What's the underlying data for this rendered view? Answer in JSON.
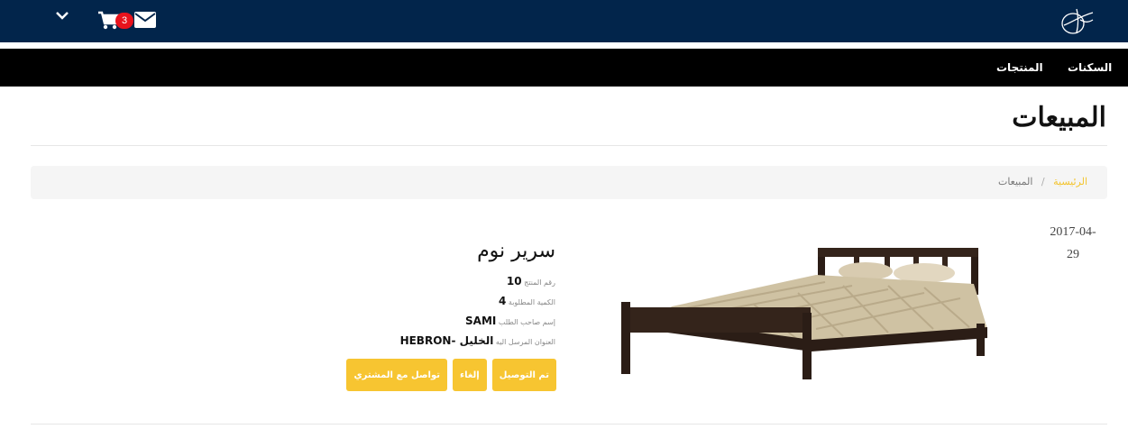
{
  "header": {
    "cart_count": "3",
    "icons": [
      "chevron-down-icon",
      "cart-icon",
      "mail-icon",
      "logo-icon"
    ]
  },
  "nav": {
    "items": [
      {
        "label": "السكنات"
      },
      {
        "label": "المنتجات"
      }
    ]
  },
  "page": {
    "title": "المبيعات"
  },
  "breadcrumb": {
    "home": "الرئيسية",
    "separator": "/",
    "current": "المبيعات"
  },
  "order": {
    "date_line1": "2017-04-",
    "date_line2": "29",
    "product_name": "سرير نوم",
    "product_id_label": "رقم المنتج",
    "product_id": "10",
    "quantity_label": "الكمية المطلوبة",
    "quantity": "4",
    "requester_label": "إسم صاحب الطلب",
    "requester": "SAMI",
    "address_label": "العنوان المرسل اليه",
    "address": "الخليل -HEBRON"
  },
  "actions": {
    "delivered": "تم التوصيل",
    "cancel": "إلغاء",
    "contact": "تواصل مع المشتري"
  },
  "colors": {
    "topbar": "#02254b",
    "navbar": "#000000",
    "accent": "#f7c531",
    "badge": "#e8131c"
  }
}
